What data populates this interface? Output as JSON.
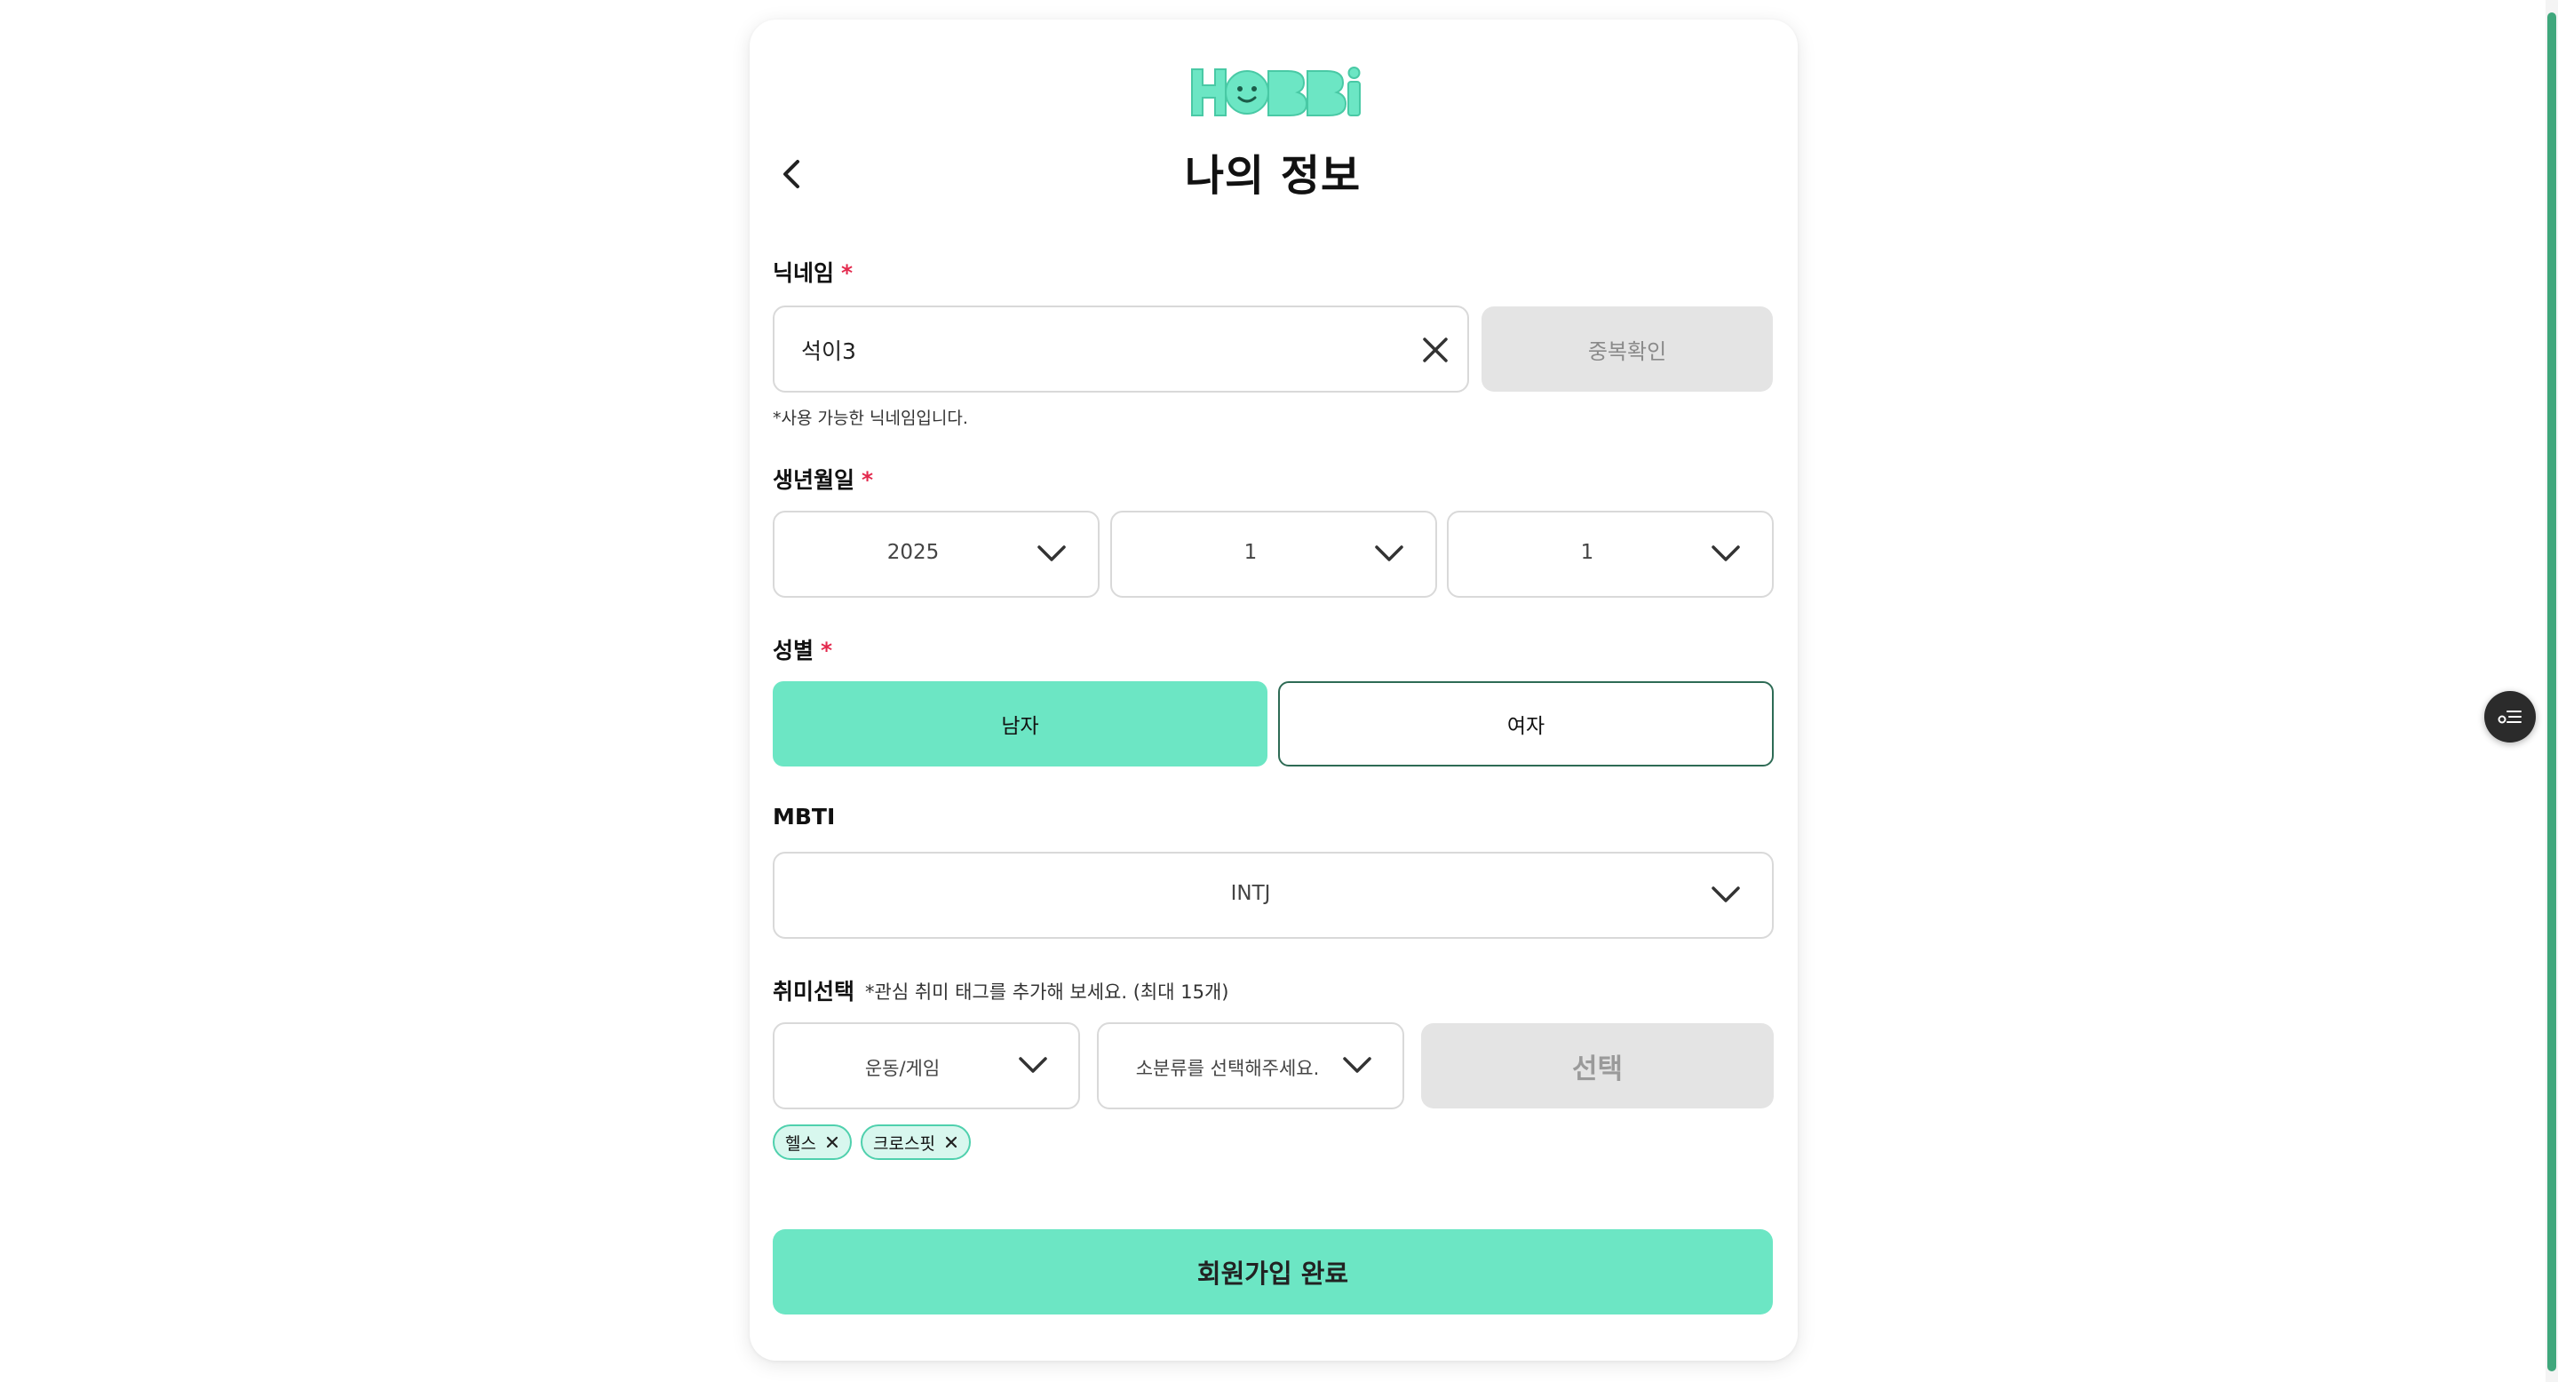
{
  "brand": {
    "logo_text": "HOBBi",
    "color": "#6ce6c4"
  },
  "header": {
    "title": "나의 정보"
  },
  "nickname": {
    "label": "닉네임",
    "required_mark": "*",
    "value": "석이3",
    "check_button": "중복확인",
    "hint": "*사용 가능한 닉네임입니다."
  },
  "birth": {
    "label": "생년월일",
    "required_mark": "*",
    "year": "2025",
    "month": "1",
    "day": "1"
  },
  "gender": {
    "label": "성별",
    "required_mark": "*",
    "options": [
      "남자",
      "여자"
    ],
    "selected": "남자"
  },
  "mbti": {
    "label": "MBTI",
    "value": "INTJ"
  },
  "hobby": {
    "label": "취미선택",
    "hint": "*관심 취미 태그를 추가해 보세요. (최대 15개)",
    "category": "운동/게임",
    "subcategory_placeholder": "소분류를 선택해주세요.",
    "select_button": "선택",
    "tags": [
      "헬스",
      "크로스핏"
    ]
  },
  "submit": {
    "label": "회원가입 완료"
  },
  "icons": {
    "back": "chevron-left-icon",
    "clear": "close-icon",
    "dropdown": "chevron-down-icon",
    "tag_remove": "close-icon",
    "floating": "filter-list-icon"
  },
  "colors": {
    "accent": "#6ce6c4",
    "required": "#e3294d",
    "disabled_bg": "#e4e4e4",
    "tag_bg": "#d8f7ee",
    "tag_border": "#4fd0ad",
    "female_border": "#2e6b55"
  }
}
